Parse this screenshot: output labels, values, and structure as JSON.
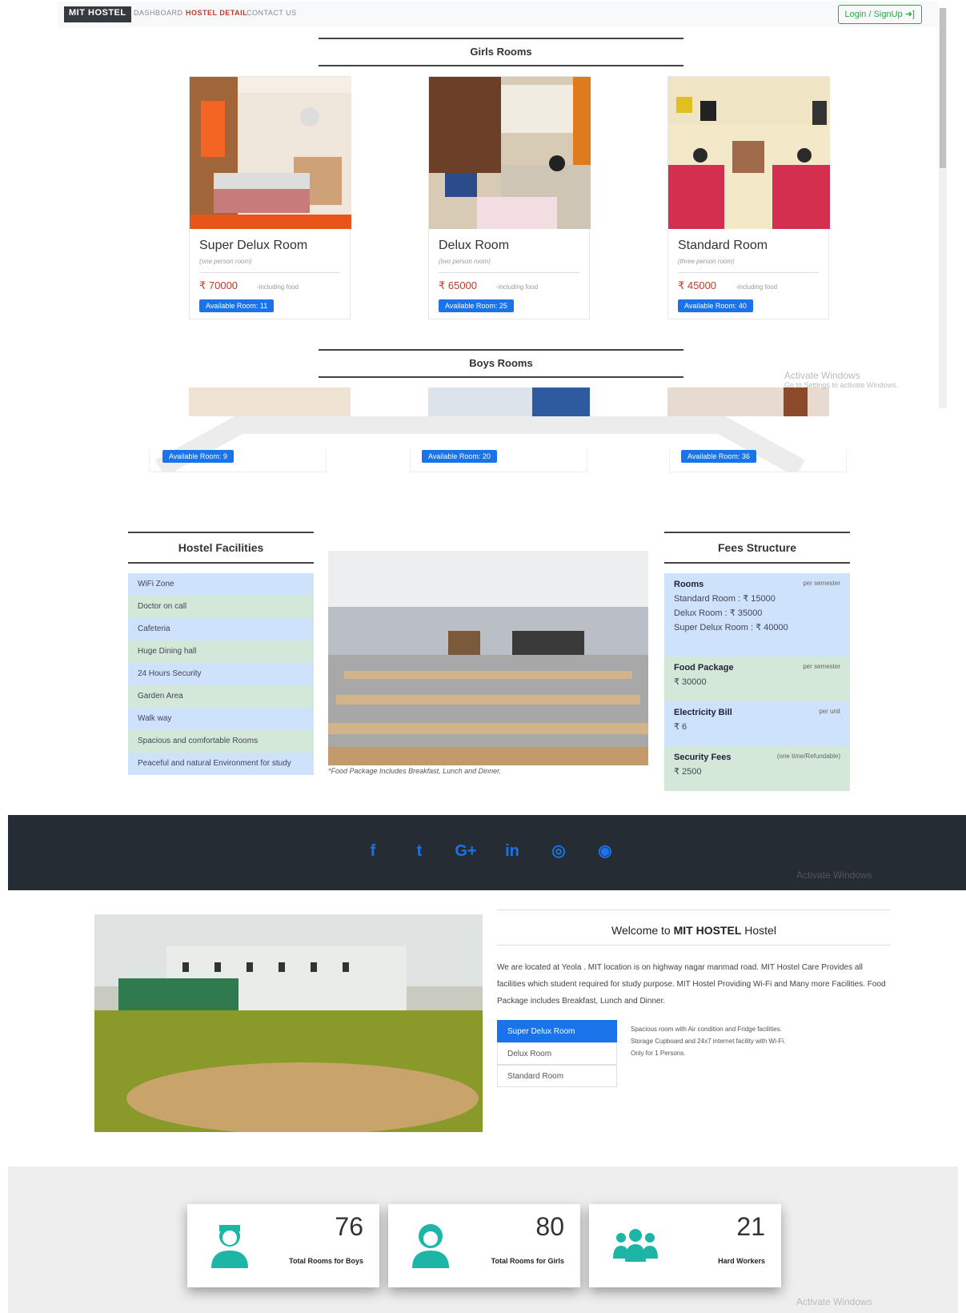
{
  "nav": {
    "brand": "MIT HOSTEL",
    "links": [
      "DASHBOARD",
      "HOSTEL DETAIL",
      "CONTACT US"
    ],
    "login": "Login / SignUp ➜]"
  },
  "girls": {
    "title": "Girls Rooms",
    "rooms": [
      {
        "name": "Super Delux Room",
        "sub": "(one person room)",
        "price": "₹ 70000",
        "note": "-including food",
        "badge": "Available Room: 11"
      },
      {
        "name": "Delux Room",
        "sub": "(two person room)",
        "price": "₹ 65000",
        "note": "-including food",
        "badge": "Available Room: 25"
      },
      {
        "name": "Standard Room",
        "sub": "(three person room)",
        "price": "₹ 45000",
        "note": "-including food",
        "badge": "Available Room: 40"
      }
    ]
  },
  "boys": {
    "title": "Boys Rooms",
    "badges": [
      "Available Room: 9",
      "Available Room: 20",
      "Available Room: 36"
    ]
  },
  "activate": {
    "title": "Activate Windows",
    "sub": "Go to Settings to activate Windows."
  },
  "facilities": {
    "title": "Hostel Facilities",
    "items": [
      "WiFi Zone",
      "Doctor on call",
      "Cafeteria",
      "Huge Dining hall",
      "24 Hours Security",
      "Garden Area",
      "Walk way",
      "Spacious and comfortable Rooms",
      "Peaceful and natural Environment for study"
    ]
  },
  "dining_caption": "*Food Package Includes Breakfast, Lunch and Dinner.",
  "fees": {
    "title": "Fees Structure",
    "rooms_label": "Rooms",
    "rooms_unit": "per semester",
    "rooms_lines": [
      "Standard Room : ₹ 15000",
      "Delux Room : ₹ 35000",
      "Super Delux Room : ₹ 40000"
    ],
    "food_label": "Food Package",
    "food_unit": "per semester",
    "food_value": "₹ 30000",
    "elec_label": "Electricity Bill",
    "elec_unit": "per unit",
    "elec_value": "₹ 6",
    "sec_label": "Security Fees",
    "sec_unit": "(one time/Refundable)",
    "sec_value": "₹ 2500"
  },
  "footer": {
    "icons": [
      "facebook-icon",
      "twitter-icon",
      "google-plus-icon",
      "linkedin-icon",
      "instagram-icon",
      "github-icon"
    ],
    "glyphs": [
      "f",
      "t",
      "G+",
      "in",
      "◎",
      "◉"
    ]
  },
  "welcome": {
    "title_pre": "Welcome to ",
    "title_bold": "MIT HOSTEL",
    "title_post": " Hostel",
    "text": "We are located at Yeola . MIT location is on highway nagar manmad road. MIT Hostel Care Provides all facilities which student required for study purpose. MIT Hostel Providing Wi-Fi and Many more Facilities. Food Package includes Breakfast, Lunch and Dinner.",
    "tabs": [
      "Super Delux Room",
      "Delux Room",
      "Standard Room"
    ],
    "tab_desc": [
      "Spacious room with Air condition and Fridge facilities.",
      "Storage Cupboard and 24x7 internet facility with Wi-Fi.",
      "Only for 1 Persons."
    ]
  },
  "stats": [
    {
      "num": "76",
      "label": "Total Rooms for Boys",
      "icon": "boy-icon"
    },
    {
      "num": "80",
      "label": "Total Rooms for Girls",
      "icon": "girl-icon"
    },
    {
      "num": "21",
      "label": "Hard Workers",
      "icon": "workers-icon"
    }
  ],
  "colors": {
    "accent": "#1a73e8",
    "footer": "#262c33",
    "teal": "#1db5a5",
    "red": "#c0392b"
  }
}
